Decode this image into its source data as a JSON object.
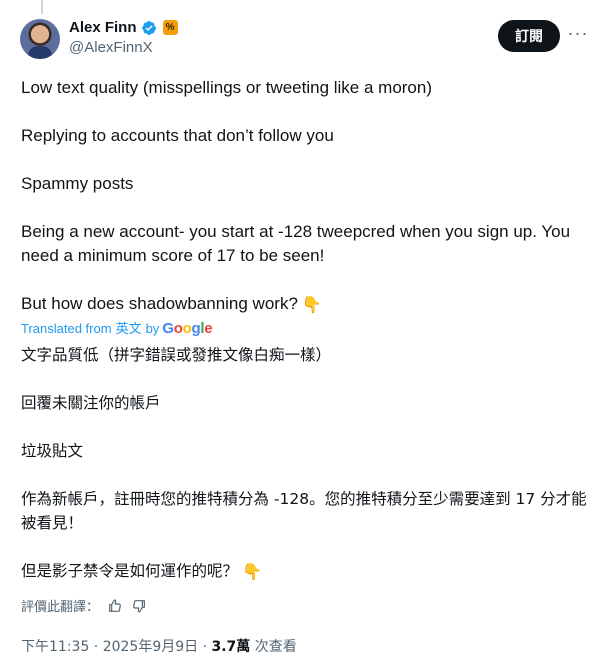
{
  "author": {
    "name": "Alex Finn",
    "handle": "@AlexFinnX",
    "org_badge": "%"
  },
  "header": {
    "subscribe_label": "訂閱",
    "more_label": "···"
  },
  "original": [
    "Low text quality (misspellings or tweeting like a moron)",
    "Replying to accounts that don’t follow you",
    "Spammy posts",
    "Being a new account- you start at -128 tweepcred when you sign up. You need a minimum score of 17 to be seen!",
    "But how does shadowbanning work?"
  ],
  "emoji": "👇",
  "translation_note": {
    "prefix": "Translated from",
    "language": "英文",
    "by": "by",
    "provider": "Google"
  },
  "translated": [
    "文字品質低（拼字錯誤或發推文像白痴一樣）",
    "回覆未關注你的帳戶",
    "垃圾貼文",
    "作為新帳戶，註冊時您的推特積分為 -128。您的推特積分至少需要達到 17 分才能被看見！",
    "但是影子禁令是如何運作的呢？"
  ],
  "rate": {
    "label": "評價此翻譯："
  },
  "meta": {
    "time": "下午11:35 · 2025年9月9日 · ",
    "views_count": "3.7萬",
    "views_label": " 次查看"
  },
  "colors": {
    "link": "#1d9bf0",
    "verified": "#1d9bf0",
    "badge": "#f59e0b"
  }
}
